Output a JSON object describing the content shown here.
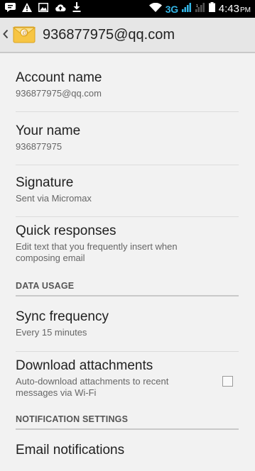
{
  "status_bar": {
    "icons_left": [
      "message-icon",
      "warning-icon",
      "image-icon",
      "cloud-upload-icon",
      "download-icon"
    ],
    "network_type": "3G",
    "time": "4:43",
    "ampm": "PM"
  },
  "action_bar": {
    "title": "936877975@qq.com"
  },
  "preferences": {
    "account_name": {
      "title": "Account name",
      "summary": "936877975@qq.com"
    },
    "your_name": {
      "title": "Your name",
      "summary": "936877975"
    },
    "signature": {
      "title": "Signature",
      "summary": "Sent via Micromax"
    },
    "quick_responses": {
      "title": "Quick responses",
      "summary": "Edit text that you frequently insert when composing email"
    },
    "data_usage_header": "DATA USAGE",
    "sync_frequency": {
      "title": "Sync frequency",
      "summary": "Every 15 minutes"
    },
    "download_attachments": {
      "title": "Download attachments",
      "summary": "Auto-download attachments to recent messages via Wi-Fi",
      "checked": false
    },
    "notification_settings_header": "NOTIFICATION SETTINGS",
    "email_notifications": {
      "title": "Email notifications"
    }
  },
  "colors": {
    "status_bar_bg": "#000000",
    "network_accent": "#33b5e5",
    "action_bar_bg": "#e6e6e6",
    "list_bg": "#f2f2f2"
  }
}
